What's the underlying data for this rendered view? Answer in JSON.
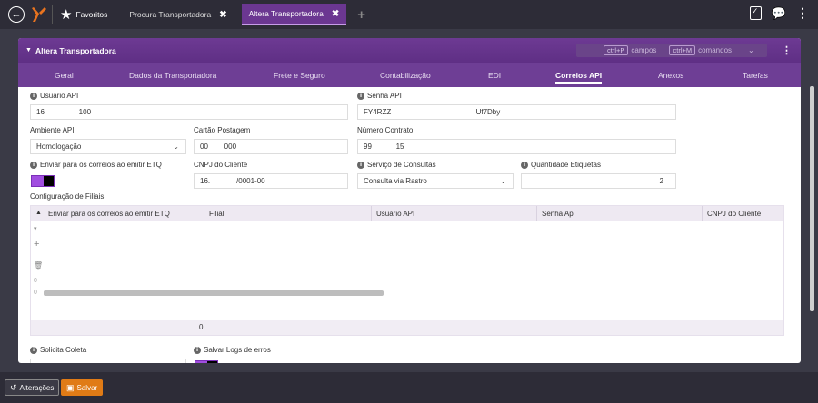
{
  "topbar": {
    "favorites_label": "Favoritos",
    "tabs": [
      {
        "label": "Procura Transportadora",
        "close": "✖"
      },
      {
        "label": "Altera Transportadora",
        "close": "✖"
      }
    ],
    "new_tab": "+"
  },
  "card": {
    "title": "Altera Transportadora",
    "shortcuts": {
      "campos_key": "ctrl+P",
      "campos_label": "campos",
      "divider": "|",
      "comandos_key": "ctrl+M",
      "comandos_label": "comandos"
    }
  },
  "tabs": [
    "Geral",
    "Dados da Transportadora",
    "Frete e Seguro",
    "Contabilização",
    "EDI",
    "Correios API",
    "Anexos",
    "Tarefas"
  ],
  "active_tab": "Correios API",
  "form": {
    "usuario_api": {
      "label": "Usuário API",
      "value": "16                 100"
    },
    "senha_api": {
      "label": "Senha API",
      "value": "FY4RZZ                                          Uf7Dby"
    },
    "ambiente_api": {
      "label": "Ambiente API",
      "value": "Homologação"
    },
    "cartao_postagem": {
      "label": "Cartão Postagem",
      "value": "00        000"
    },
    "numero_contrato": {
      "label": "Número Contrato",
      "value": "99            15"
    },
    "enviar_correios": {
      "label": "Enviar para os correios ao emitir ETQ"
    },
    "cnpj_cliente": {
      "label": "CNPJ do Cliente",
      "value": "16.             /0001-00"
    },
    "servico_consultas": {
      "label": "Serviço de Consultas",
      "value": "Consulta via Rastro"
    },
    "quantidade_etiquetas": {
      "label": "Quantidade Etiquetas",
      "value": "2"
    },
    "filiais_label": "Configuração de Filiais",
    "solicita_coleta": {
      "label": "Solicita Coleta",
      "value": ""
    },
    "salvar_logs": {
      "label": "Salvar Logs de erros"
    }
  },
  "grid": {
    "columns": [
      "Enviar para os correios ao emitir ETQ",
      "Filial",
      "Usuário API",
      "Senha Api",
      "CNPJ do Cliente"
    ],
    "side_icons": [
      "▾",
      "+",
      "🗑",
      "0",
      "0"
    ],
    "footer_count": "0"
  },
  "bottombar": {
    "alteracoes_label": "Alterações",
    "salvar_label": "Salvar"
  },
  "colors": {
    "accent": "#6e3e95",
    "save": "#e07b16",
    "toggle": "#a14ee0"
  }
}
